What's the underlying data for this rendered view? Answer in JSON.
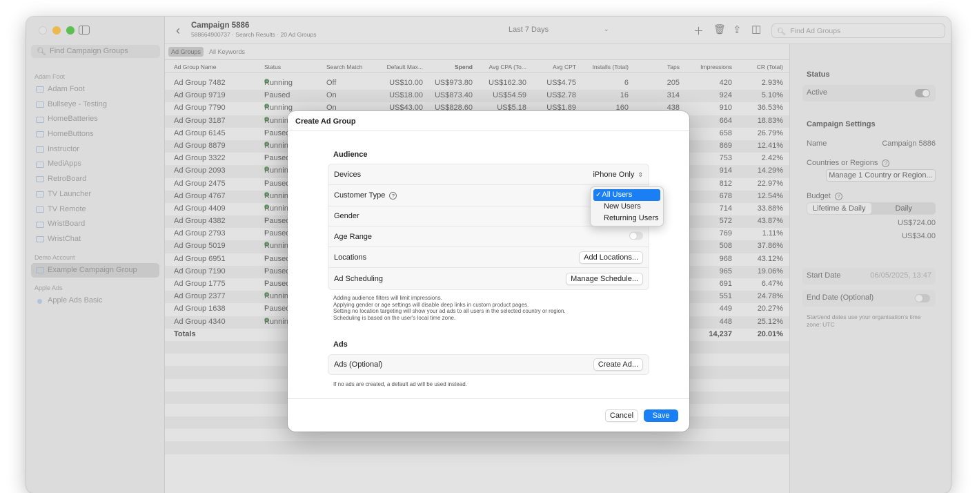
{
  "window": {
    "title": "Campaign 5886",
    "subtitle": "588664900737 · Search Results · 20 Ad Groups",
    "date_range": "Last 7 Days",
    "search_placeholder": "Find Ad Groups"
  },
  "sidebar": {
    "search_placeholder": "Find Campaign Groups",
    "sections": [
      {
        "header": "Adam Foot",
        "items": [
          "Adam Foot",
          "Bullseye - Testing",
          "HomeBatteries",
          "HomeButtons",
          "Instructor",
          "MediApps",
          "RetroBoard",
          "TV Launcher",
          "TV Remote",
          "WristBoard",
          "WristChat"
        ]
      },
      {
        "header": "Demo Account",
        "items": [
          "Example Campaign Group"
        ]
      },
      {
        "header": "Apple Ads",
        "items": [
          "Apple Ads Basic"
        ]
      }
    ]
  },
  "tabs": [
    "Ad Groups",
    "All Keywords"
  ],
  "table": {
    "columns": [
      "Ad Group Name",
      "Status",
      "Search Match",
      "Default Max...",
      "Spend",
      "Avg CPA (To...",
      "Avg CPT",
      "Installs (Total)",
      "Taps",
      "Impressions",
      "CR (Total)"
    ],
    "rows": [
      [
        "Ad Group 7482",
        "Running",
        "Off",
        "US$10.00",
        "US$973.80",
        "US$162.30",
        "US$4.75",
        "6",
        "205",
        "420",
        "2.93%"
      ],
      [
        "Ad Group 9719",
        "Paused",
        "On",
        "US$18.00",
        "US$873.40",
        "US$54.59",
        "US$2.78",
        "16",
        "314",
        "924",
        "5.10%"
      ],
      [
        "Ad Group 7790",
        "Running",
        "On",
        "US$43.00",
        "US$828.60",
        "US$5.18",
        "US$1.89",
        "160",
        "438",
        "910",
        "36.53%"
      ],
      [
        "Ad Group 3187",
        "Running",
        "",
        "",
        "",
        "",
        "",
        "",
        "",
        "664",
        "18.83%"
      ],
      [
        "Ad Group 6145",
        "Paused",
        "",
        "",
        "",
        "",
        "",
        "",
        "",
        "658",
        "26.79%"
      ],
      [
        "Ad Group 8879",
        "Running",
        "",
        "",
        "",
        "",
        "",
        "",
        "",
        "869",
        "12.41%"
      ],
      [
        "Ad Group 3322",
        "Paused",
        "",
        "",
        "",
        "",
        "",
        "",
        "",
        "753",
        "2.42%"
      ],
      [
        "Ad Group 2093",
        "Running",
        "",
        "",
        "",
        "",
        "",
        "",
        "",
        "914",
        "14.29%"
      ],
      [
        "Ad Group 2475",
        "Paused",
        "",
        "",
        "",
        "",
        "",
        "",
        "",
        "812",
        "22.97%"
      ],
      [
        "Ad Group 4767",
        "Running",
        "",
        "",
        "",
        "",
        "",
        "",
        "",
        "678",
        "12.54%"
      ],
      [
        "Ad Group 4409",
        "Running",
        "",
        "",
        "",
        "",
        "",
        "",
        "",
        "714",
        "33.88%"
      ],
      [
        "Ad Group 4382",
        "Paused",
        "",
        "",
        "",
        "",
        "",
        "",
        "",
        "572",
        "43.87%"
      ],
      [
        "Ad Group 2793",
        "Paused",
        "",
        "",
        "",
        "",
        "",
        "",
        "",
        "769",
        "1.11%"
      ],
      [
        "Ad Group 5019",
        "Running",
        "",
        "",
        "",
        "",
        "",
        "",
        "",
        "508",
        "37.86%"
      ],
      [
        "Ad Group 6951",
        "Paused",
        "",
        "",
        "",
        "",
        "",
        "",
        "",
        "968",
        "43.12%"
      ],
      [
        "Ad Group 7190",
        "Paused",
        "",
        "",
        "",
        "",
        "",
        "",
        "",
        "965",
        "19.06%"
      ],
      [
        "Ad Group 1775",
        "Paused",
        "",
        "",
        "",
        "",
        "",
        "",
        "",
        "691",
        "6.47%"
      ],
      [
        "Ad Group 2377",
        "Running",
        "",
        "",
        "",
        "",
        "",
        "",
        "",
        "551",
        "24.78%"
      ],
      [
        "Ad Group 1638",
        "Paused",
        "",
        "",
        "",
        "",
        "",
        "",
        "",
        "449",
        "20.27%"
      ],
      [
        "Ad Group 4340",
        "Running",
        "",
        "",
        "",
        "",
        "",
        "",
        "",
        "448",
        "25.12%"
      ]
    ],
    "totals": {
      "label": "Totals",
      "impressions": "14,237",
      "cr": "20.01%"
    }
  },
  "inspector": {
    "status_header": "Status",
    "active_label": "Active",
    "settings_header": "Campaign Settings",
    "name_label": "Name",
    "name_value": "Campaign 5886",
    "countries_label": "Countries or Regions",
    "countries_button": "Manage 1 Country or Region...",
    "budget_label": "Budget",
    "budget_options": [
      "Lifetime & Daily",
      "Daily"
    ],
    "budget_lifetime": "US$724.00",
    "budget_daily": "US$34.00",
    "start_label": "Start Date",
    "start_value": "06/05/2025, 13:47",
    "end_label": "End Date (Optional)",
    "note": "Start/end dates use your organisation's time zone: UTC"
  },
  "modal": {
    "title": "Create Ad Group",
    "audience_header": "Audience",
    "devices_label": "Devices",
    "devices_value": "iPhone Only",
    "customer_type_label": "Customer Type",
    "gender_label": "Gender",
    "age_range_label": "Age Range",
    "locations_label": "Locations",
    "locations_button": "Add Locations...",
    "scheduling_label": "Ad Scheduling",
    "scheduling_button": "Manage Schedule...",
    "notes": [
      "Adding audience filters will limit impressions.",
      "Applying gender or age settings will disable deep links in custom product pages.",
      "Setting no location targeting will show your ad ads to all users in the selected country or region.",
      "Scheduling is based on the user's local time zone."
    ],
    "ads_header": "Ads",
    "ads_label": "Ads (Optional)",
    "ads_button": "Create Ad...",
    "ads_note": "If no ads are created, a default ad will be used instead.",
    "cancel": "Cancel",
    "save": "Save"
  },
  "dropdown": {
    "selected": "All Users",
    "options": [
      "All Users",
      "New Users",
      "Returning Users"
    ]
  },
  "colors": {
    "accent": "#1a7ef5",
    "running": "#7ab87a",
    "traffic_min": "#f4bf4f",
    "traffic_max": "#61c554"
  }
}
